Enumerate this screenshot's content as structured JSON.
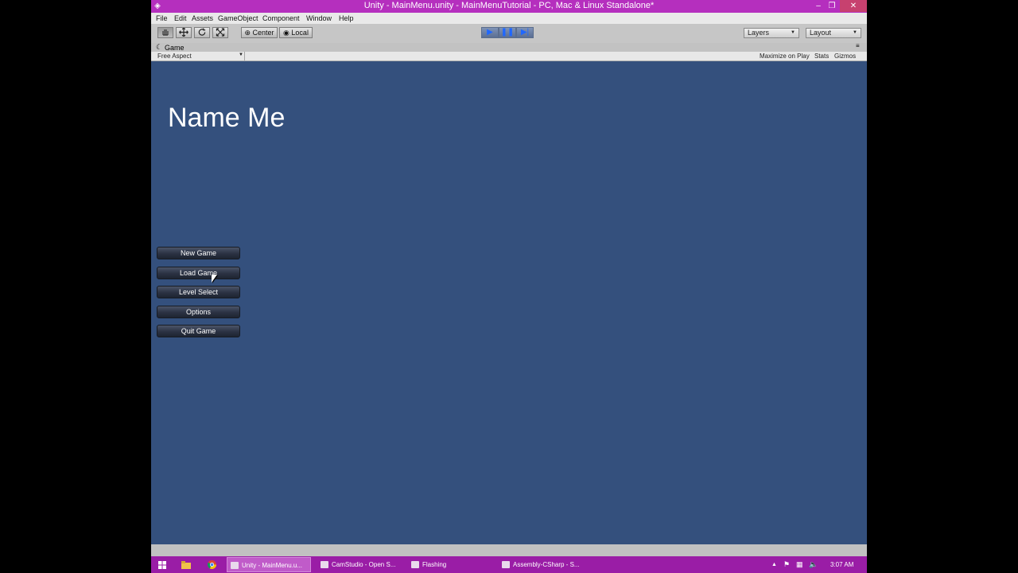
{
  "window": {
    "title": "Unity - MainMenu.unity - MainMenuTutorial - PC, Mac & Linux Standalone*",
    "app_icon": "unity-logo-icon",
    "minimize": "–",
    "restore": "❐",
    "close": "✕"
  },
  "menu": [
    "File",
    "Edit",
    "Assets",
    "GameObject",
    "Component",
    "Window",
    "Help"
  ],
  "toolbar": {
    "tools": [
      "hand-tool-icon",
      "move-tool-icon",
      "rotate-tool-icon",
      "scale-tool-icon"
    ],
    "pivot": "Center",
    "space": "Local",
    "play_icon": "▶",
    "pause_icon": "❚❚",
    "step_icon": "▶|",
    "layers": "Layers",
    "layout": "Layout"
  },
  "game_tab": {
    "label": "Game",
    "aspect": "Free Aspect",
    "maximize": "Maximize on Play",
    "stats": "Stats",
    "gizmos": "Gizmos"
  },
  "game": {
    "title": "Name Me",
    "buttons": [
      "New Game",
      "Load Game",
      "Level Select",
      "Options",
      "Quit Game"
    ]
  },
  "taskbar": {
    "tasks": [
      "Unity - MainMenu.u...",
      "CamStudio - Open S...",
      "Flashing",
      "Assembly-CSharp - S..."
    ],
    "clock": "3:07 AM"
  },
  "colors": {
    "title_bar": "#b52fbe",
    "taskbar": "#9a1da6",
    "game_background": "#34507d"
  }
}
